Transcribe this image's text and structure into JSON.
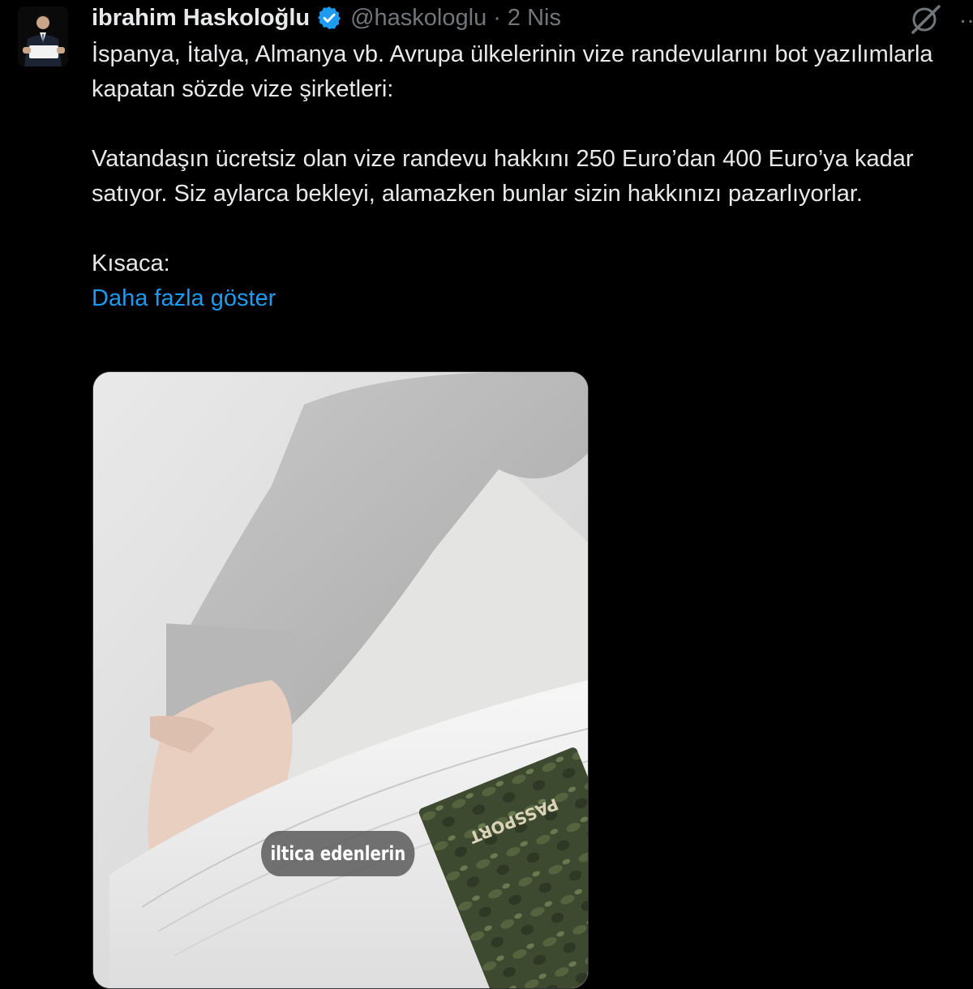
{
  "tweet": {
    "author_name": "ibrahim Haskoloğlu",
    "handle": "@haskologlu",
    "separator": "·",
    "date": "2 Nis",
    "paragraph1": "İspanya, İtalya, Almanya vb. Avrupa ülkelerinin vize randevularını bot yazılımlarla kapatan sözde vize şirketleri:",
    "paragraph2": "Vatandaşın ücretsiz olan vize randevu hakkını 250 Euro’dan 400 Euro’ya kadar satıyor. Siz aylarca bekleyi, alamazken bunlar sizin hakkınızı pazarlıyorlar.",
    "paragraph3": "Kısaca:",
    "show_more": "Daha fazla göster",
    "more_icon": "…"
  },
  "media": {
    "caption": "iltica edenlerin",
    "passport_label": "PASSPORT"
  },
  "colors": {
    "background": "#000000",
    "text": "#e7e9ea",
    "muted": "#71767b",
    "link": "#1d9bf0",
    "verified": "#1d9bf0"
  },
  "icons": {
    "verified": "verified-badge-icon",
    "top_right": "grok-icon",
    "more": "more-options-icon"
  }
}
